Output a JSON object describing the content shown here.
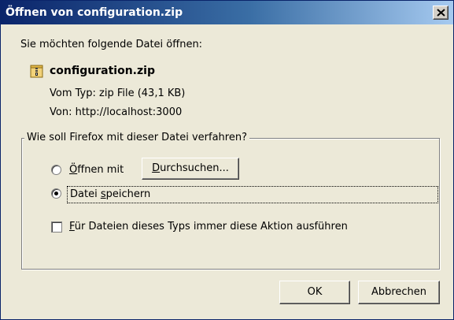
{
  "window": {
    "title": "Öffnen von configuration.zip"
  },
  "dialog": {
    "intro": "Sie möchten folgende Datei öffnen:",
    "file": {
      "icon": "zip-archive-icon",
      "name": "configuration.zip",
      "type": "Vom Typ:  zip File (43,1 KB)",
      "source": "Von:  http://localhost:3000"
    },
    "group": {
      "legend": "Wie soll Firefox mit dieser Datei verfahren?",
      "open_with": {
        "accesskey": "Ö",
        "rest": "ffnen mit",
        "selected": false
      },
      "browse": {
        "accesskey": "D",
        "rest": "urchsuchen..."
      },
      "save": {
        "before": "Datei ",
        "accesskey": "s",
        "rest": "peichern",
        "selected": true
      },
      "always": {
        "accesskey": "F",
        "rest": "ür Dateien dieses Typs immer diese Aktion ausführen",
        "checked": false
      }
    },
    "buttons": {
      "ok": "OK",
      "cancel": "Abbrechen"
    }
  },
  "colors": {
    "titlebar_start": "#0a246a",
    "titlebar_end": "#a6caf0",
    "dialog_bg": "#ece9d8"
  }
}
